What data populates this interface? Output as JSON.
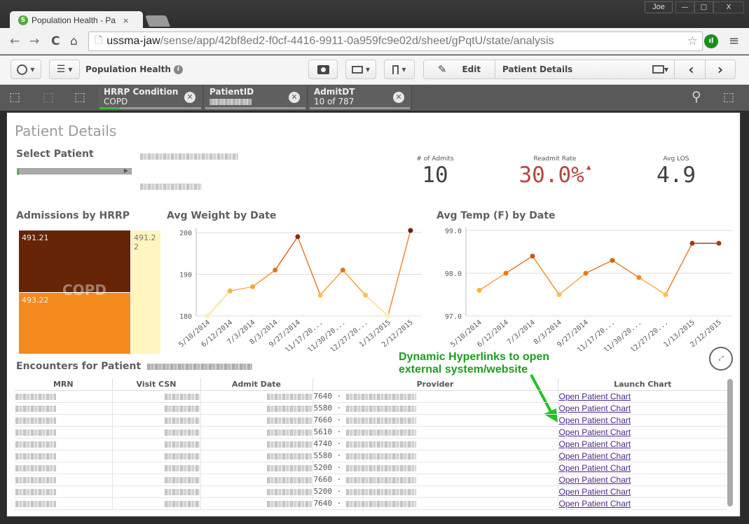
{
  "browser": {
    "tab_title": "Population Health - Patier",
    "tab_close": "×",
    "favicon": "S",
    "user": "Joe",
    "window_controls": {
      "minimize": "—",
      "maximize": "□",
      "close": "X"
    },
    "url_host": "ussma-jaw",
    "url_path": "/sense/app/42bf8ed2-f0cf-4416-9911-0a959fc9e02d/sheet/gPqtU/state/analysis",
    "nav": {
      "back": "←",
      "forward": "→",
      "reload": "C",
      "home": "⌂"
    },
    "icons": {
      "page": "🗋",
      "star": "☆",
      "menu": "≡",
      "extension": "ıl"
    }
  },
  "toolbar": {
    "app_name": "Population Health",
    "info": "i",
    "edit_label": "Edit",
    "sheet_name": "Patient Details",
    "prev": "‹",
    "next": "›"
  },
  "selections": {
    "chips": [
      {
        "field": "HRRP Condition",
        "value": "COPD",
        "fill": 0.2
      },
      {
        "field": "PatientID",
        "value": "",
        "fill": 0.0
      },
      {
        "field": "AdmitDT",
        "value": "10 of 787",
        "fill": 0.0
      }
    ]
  },
  "sheet": {
    "title": "Patient Details",
    "select_patient_label": "Select Patient",
    "kpis": [
      {
        "label": "# of Admits",
        "value": "10",
        "color": "#404040"
      },
      {
        "label": "Readmit Rate",
        "value": "30.0%",
        "color": "#b5463f",
        "alert": "▲"
      },
      {
        "label": "Avg LOS",
        "value": "4.9",
        "color": "#404040"
      }
    ]
  },
  "treemap": {
    "title": "Admissions by HRRP",
    "watermark": "COPD",
    "cells": [
      {
        "label": "491.21",
        "color": "#662506"
      },
      {
        "label": "493.22",
        "color": "#f38b1f"
      },
      {
        "label": "491.2\n2",
        "color": "#fff5bf"
      }
    ]
  },
  "chart_data": [
    {
      "type": "line",
      "title": "Avg Weight by Date",
      "categories": [
        "5/10/2014",
        "6/12/2014",
        "7/3/2014",
        "8/3/2014",
        "9/27/2014",
        "11/17/20...",
        "11/30/20...",
        "12/27/20...",
        "1/13/2015",
        "2/12/2015"
      ],
      "values": [
        180,
        186,
        187,
        191,
        199,
        185,
        191,
        185,
        180,
        200.5
      ],
      "yticks": [
        "180",
        "190",
        "200"
      ],
      "ylim": [
        180,
        200.5
      ],
      "grid": true
    },
    {
      "type": "line",
      "title": "Avg Temp (F) by Date",
      "categories": [
        "5/10/2014",
        "6/12/2014",
        "7/3/2014",
        "8/3/2014",
        "9/27/2014",
        "11/17/20...",
        "11/30/20...",
        "12/27/20...",
        "1/13/2015",
        "2/12/2015"
      ],
      "values": [
        97.6,
        98.0,
        98.4,
        97.5,
        98.0,
        98.3,
        97.9,
        97.5,
        98.7,
        98.7
      ],
      "yticks": [
        "97.0",
        "98.0",
        "99.0"
      ],
      "ylim": [
        97.0,
        99.0
      ],
      "grid": true
    }
  ],
  "annotation": {
    "line1": "Dynamic Hyperlinks to open",
    "line2": "external system/website",
    "color": "#1e9c1e"
  },
  "encounters": {
    "title": "Encounters for Patient",
    "columns": [
      "MRN",
      "Visit CSN",
      "Admit Date",
      "Provider",
      "Launch Chart"
    ],
    "rows": [
      {
        "provider_id": "7640",
        "link": "Open Patient Chart"
      },
      {
        "provider_id": "5580",
        "link": "Open Patient Chart"
      },
      {
        "provider_id": "7660",
        "link": "Open Patient Chart"
      },
      {
        "provider_id": "5610",
        "link": "Open Patient Chart"
      },
      {
        "provider_id": "4740",
        "link": "Open Patient Chart"
      },
      {
        "provider_id": "5580",
        "link": "Open Patient Chart"
      },
      {
        "provider_id": "5200",
        "link": "Open Patient Chart"
      },
      {
        "provider_id": "7660",
        "link": "Open Patient Chart"
      },
      {
        "provider_id": "5200",
        "link": "Open Patient Chart"
      },
      {
        "provider_id": "7640",
        "link": "Open Patient Chart"
      }
    ]
  }
}
